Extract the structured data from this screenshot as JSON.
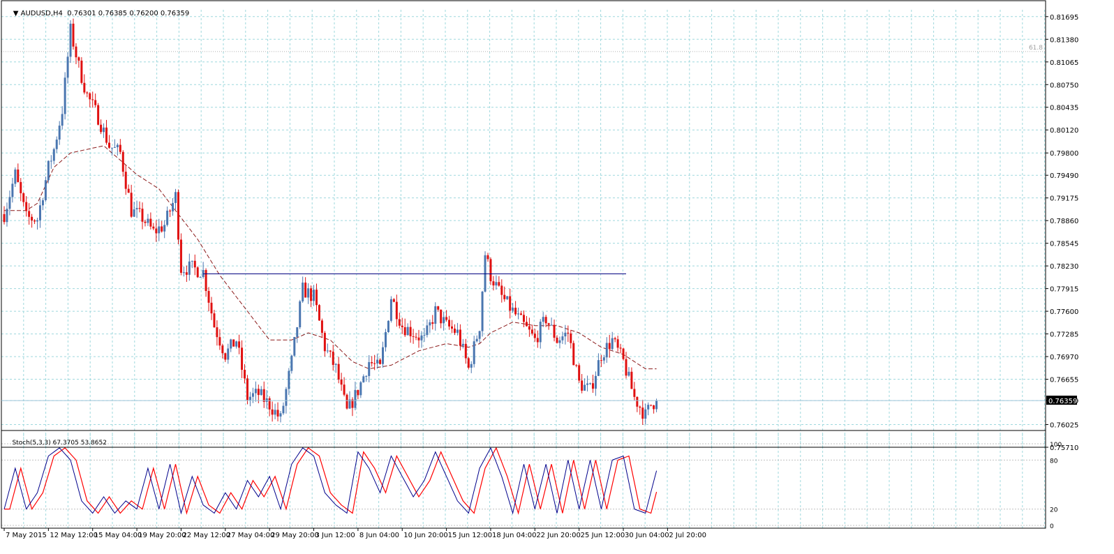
{
  "header": {
    "arrow": "▼",
    "symbol": "AUDUSD,H4",
    "ohlc": "0.76301 0.76385 0.76200 0.76359"
  },
  "subwindow": {
    "label": "Stoch(5,3,3) 67.3705 53.8652"
  },
  "colors": {
    "bull": "#4a76b0",
    "bear": "#e01010",
    "ma": "#8b1a1a",
    "grid": "#9ed8dd",
    "stoch_main": "#00008b",
    "stoch_signal": "#ff0000",
    "hline": "#000080",
    "price_tag_bg": "#000000",
    "price_tag_fg": "#ffffff"
  },
  "chart_data": {
    "type": "candlestick",
    "symbol": "AUDUSD",
    "timeframe": "H4",
    "price_axis_ticks": [
      "0.81695",
      "0.81380",
      "0.81065",
      "0.80750",
      "0.80435",
      "0.80120",
      "0.79800",
      "0.79490",
      "0.79175",
      "0.78860",
      "0.78545",
      "0.78230",
      "0.77915",
      "0.77600",
      "0.77285",
      "0.76970",
      "0.76655",
      "0.76359",
      "0.76025",
      "0.75710"
    ],
    "ylim": [
      0.7571,
      0.8179
    ],
    "current_price": "0.76359",
    "fib_label": "61.8",
    "fib_level": 0.8121,
    "resistance_line": {
      "price": 0.7812,
      "from_index": 72,
      "to_index": 225
    },
    "time_axis_labels": [
      "7 May 2015",
      "12 May 12:00",
      "15 May 04:00",
      "19 May 20:00",
      "22 May 12:00",
      "27 May 04:00",
      "29 May 20:00",
      "3 Jun 12:00",
      "8 Jun 04:00",
      "10 Jun 20:00",
      "15 Jun 12:00",
      "18 Jun 04:00",
      "22 Jun 20:00",
      "25 Jun 12:00",
      "30 Jun 04:00",
      "2 Jul 20:00"
    ],
    "time_label_indices": [
      0,
      16,
      32,
      48,
      64,
      80,
      96,
      112,
      128,
      144,
      160,
      176,
      192,
      208,
      224,
      240
    ],
    "keypoints": [
      [
        0,
        0.7895
      ],
      [
        4,
        0.795
      ],
      [
        8,
        0.789
      ],
      [
        12,
        0.7888
      ],
      [
        16,
        0.796
      ],
      [
        18,
        0.7985
      ],
      [
        21,
        0.804
      ],
      [
        24,
        0.815
      ],
      [
        27,
        0.81
      ],
      [
        30,
        0.806
      ],
      [
        34,
        0.803
      ],
      [
        38,
        0.799
      ],
      [
        42,
        0.798
      ],
      [
        46,
        0.79
      ],
      [
        50,
        0.789
      ],
      [
        54,
        0.787
      ],
      [
        58,
        0.788
      ],
      [
        62,
        0.792
      ],
      [
        64,
        0.782
      ],
      [
        68,
        0.782
      ],
      [
        72,
        0.7815
      ],
      [
        76,
        0.774
      ],
      [
        80,
        0.77
      ],
      [
        84,
        0.772
      ],
      [
        88,
        0.764
      ],
      [
        92,
        0.7645
      ],
      [
        96,
        0.763
      ],
      [
        100,
        0.761
      ],
      [
        104,
        0.769
      ],
      [
        108,
        0.779
      ],
      [
        112,
        0.778
      ],
      [
        116,
        0.771
      ],
      [
        120,
        0.768
      ],
      [
        124,
        0.762
      ],
      [
        128,
        0.765
      ],
      [
        132,
        0.769
      ],
      [
        136,
        0.768
      ],
      [
        140,
        0.778
      ],
      [
        144,
        0.774
      ],
      [
        148,
        0.773
      ],
      [
        152,
        0.772
      ],
      [
        156,
        0.776
      ],
      [
        160,
        0.774
      ],
      [
        164,
        0.773
      ],
      [
        168,
        0.768
      ],
      [
        172,
        0.774
      ],
      [
        174,
        0.784
      ],
      [
        176,
        0.781
      ],
      [
        180,
        0.778
      ],
      [
        184,
        0.776
      ],
      [
        188,
        0.774
      ],
      [
        192,
        0.772
      ],
      [
        196,
        0.775
      ],
      [
        200,
        0.772
      ],
      [
        204,
        0.773
      ],
      [
        208,
        0.766
      ],
      [
        212,
        0.765
      ],
      [
        216,
        0.77
      ],
      [
        220,
        0.772
      ],
      [
        224,
        0.769
      ],
      [
        228,
        0.764
      ],
      [
        232,
        0.7615
      ],
      [
        234,
        0.763
      ],
      [
        236,
        0.7636
      ]
    ],
    "stoch_keypoints": [
      [
        0,
        20
      ],
      [
        4,
        70
      ],
      [
        8,
        20
      ],
      [
        12,
        40
      ],
      [
        16,
        85
      ],
      [
        20,
        95
      ],
      [
        24,
        80
      ],
      [
        28,
        30
      ],
      [
        32,
        15
      ],
      [
        36,
        35
      ],
      [
        40,
        15
      ],
      [
        44,
        30
      ],
      [
        48,
        20
      ],
      [
        52,
        70
      ],
      [
        56,
        20
      ],
      [
        60,
        75
      ],
      [
        64,
        15
      ],
      [
        68,
        60
      ],
      [
        72,
        25
      ],
      [
        76,
        15
      ],
      [
        80,
        40
      ],
      [
        84,
        20
      ],
      [
        88,
        55
      ],
      [
        92,
        35
      ],
      [
        96,
        60
      ],
      [
        100,
        20
      ],
      [
        104,
        75
      ],
      [
        108,
        95
      ],
      [
        112,
        85
      ],
      [
        116,
        40
      ],
      [
        120,
        25
      ],
      [
        124,
        15
      ],
      [
        128,
        90
      ],
      [
        132,
        70
      ],
      [
        136,
        40
      ],
      [
        140,
        85
      ],
      [
        144,
        60
      ],
      [
        148,
        35
      ],
      [
        152,
        55
      ],
      [
        156,
        90
      ],
      [
        160,
        60
      ],
      [
        164,
        30
      ],
      [
        168,
        15
      ],
      [
        172,
        70
      ],
      [
        176,
        95
      ],
      [
        180,
        60
      ],
      [
        184,
        15
      ],
      [
        188,
        75
      ],
      [
        192,
        20
      ],
      [
        196,
        75
      ],
      [
        200,
        15
      ],
      [
        204,
        80
      ],
      [
        208,
        20
      ],
      [
        212,
        80
      ],
      [
        216,
        20
      ],
      [
        220,
        80
      ],
      [
        224,
        85
      ],
      [
        228,
        20
      ],
      [
        232,
        15
      ],
      [
        236,
        67
      ]
    ],
    "stoch_levels": [
      0,
      20,
      80,
      100
    ],
    "stoch_main_value": 67.3705,
    "stoch_signal_value": 53.8652,
    "ma_keypoints": [
      [
        0,
        0.79
      ],
      [
        8,
        0.79
      ],
      [
        12,
        0.791
      ],
      [
        18,
        0.796
      ],
      [
        24,
        0.798
      ],
      [
        30,
        0.7985
      ],
      [
        36,
        0.799
      ],
      [
        42,
        0.797
      ],
      [
        48,
        0.795
      ],
      [
        56,
        0.793
      ],
      [
        62,
        0.79
      ],
      [
        70,
        0.786
      ],
      [
        78,
        0.781
      ],
      [
        88,
        0.776
      ],
      [
        96,
        0.772
      ],
      [
        104,
        0.772
      ],
      [
        110,
        0.773
      ],
      [
        118,
        0.772
      ],
      [
        126,
        0.769
      ],
      [
        132,
        0.768
      ],
      [
        140,
        0.7685
      ],
      [
        150,
        0.7705
      ],
      [
        160,
        0.7715
      ],
      [
        168,
        0.771
      ],
      [
        172,
        0.7715
      ],
      [
        176,
        0.773
      ],
      [
        184,
        0.7745
      ],
      [
        192,
        0.774
      ],
      [
        200,
        0.774
      ],
      [
        208,
        0.773
      ],
      [
        216,
        0.771
      ],
      [
        224,
        0.77
      ],
      [
        232,
        0.768
      ],
      [
        236,
        0.768
      ]
    ]
  }
}
